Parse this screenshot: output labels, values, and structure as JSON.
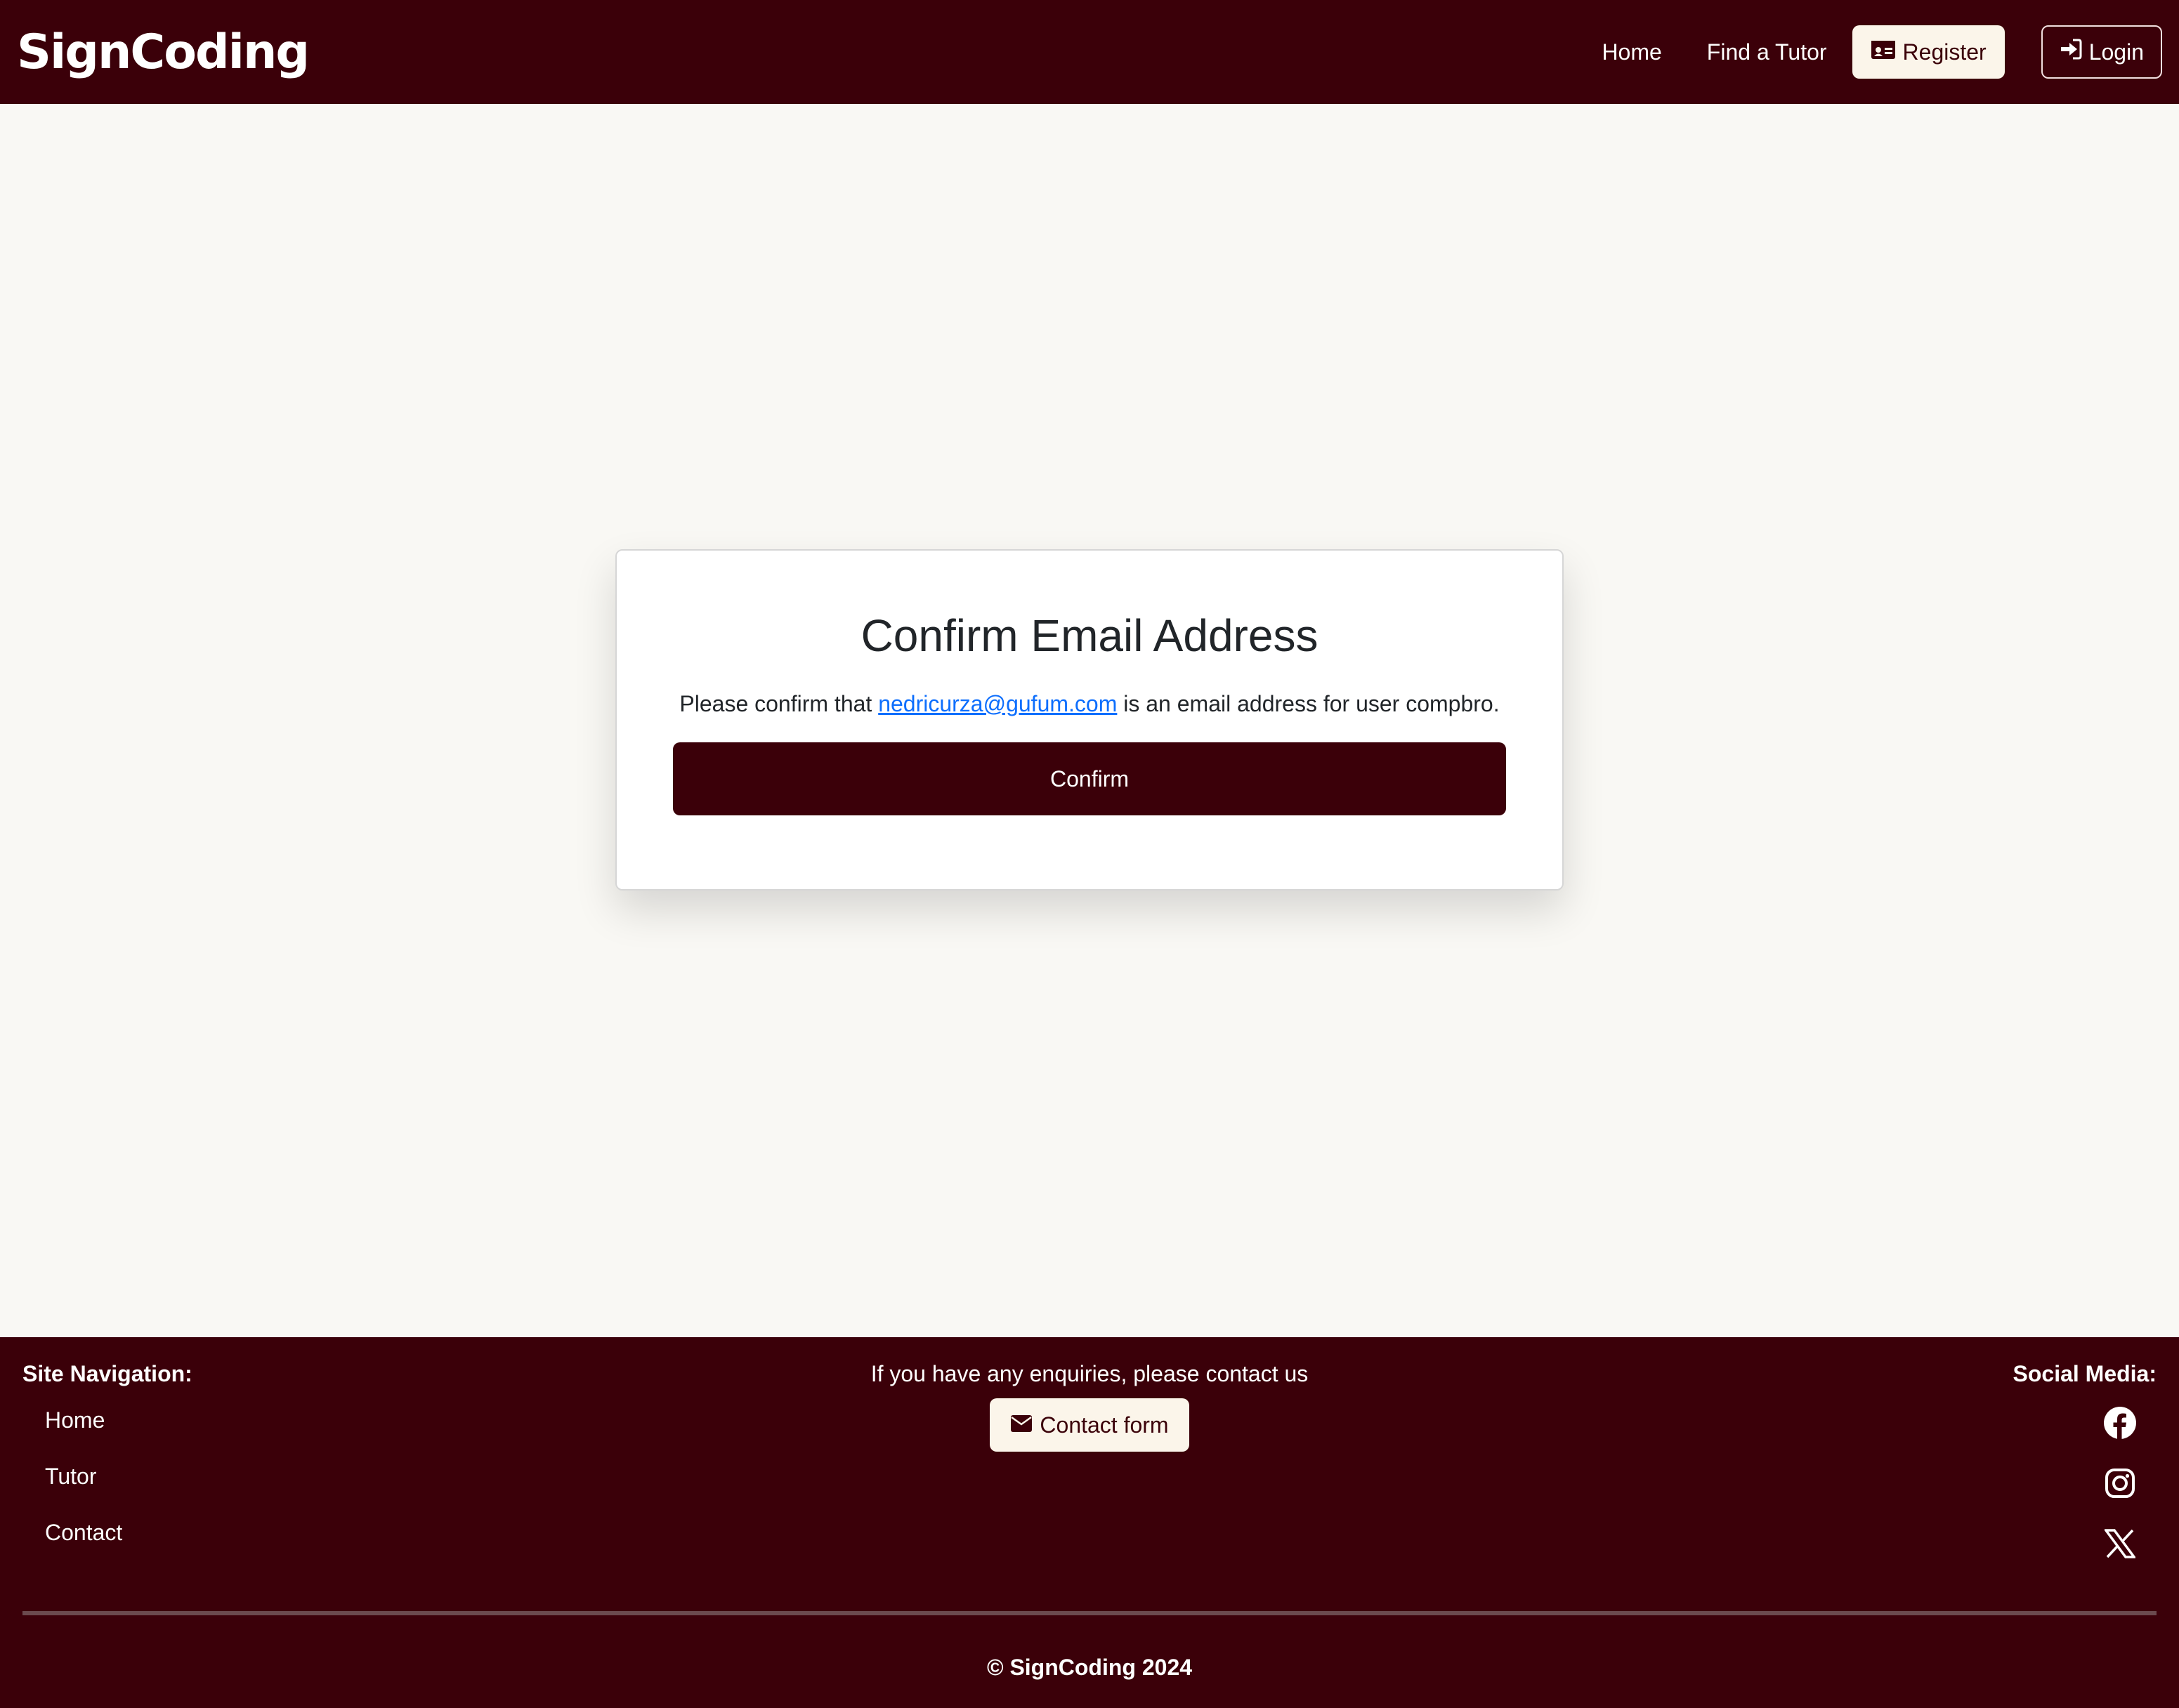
{
  "header": {
    "brand": "SignCoding",
    "nav": [
      "Home",
      "Find a Tutor"
    ],
    "register_label": "Register",
    "login_label": "Login"
  },
  "card": {
    "title": "Confirm Email Address",
    "text_before": "Please confirm that ",
    "email": "nedricurza@gufum.com",
    "text_after": " is an email address for user compbro.",
    "confirm_label": "Confirm"
  },
  "footer": {
    "nav_title": "Site Navigation:",
    "nav_items": [
      "Home",
      "Tutor",
      "Contact"
    ],
    "contact_text": "If you have any enquiries, please contact us",
    "contact_button": "Contact form",
    "social_title": "Social Media:",
    "social_icons": [
      "facebook-icon",
      "instagram-icon",
      "x-icon"
    ],
    "copyright": "© SignCoding 2024"
  },
  "colors": {
    "brand": "#3b0009",
    "cream": "#fbf5ea",
    "background": "#f9f8f4",
    "link": "#0d6efd"
  }
}
